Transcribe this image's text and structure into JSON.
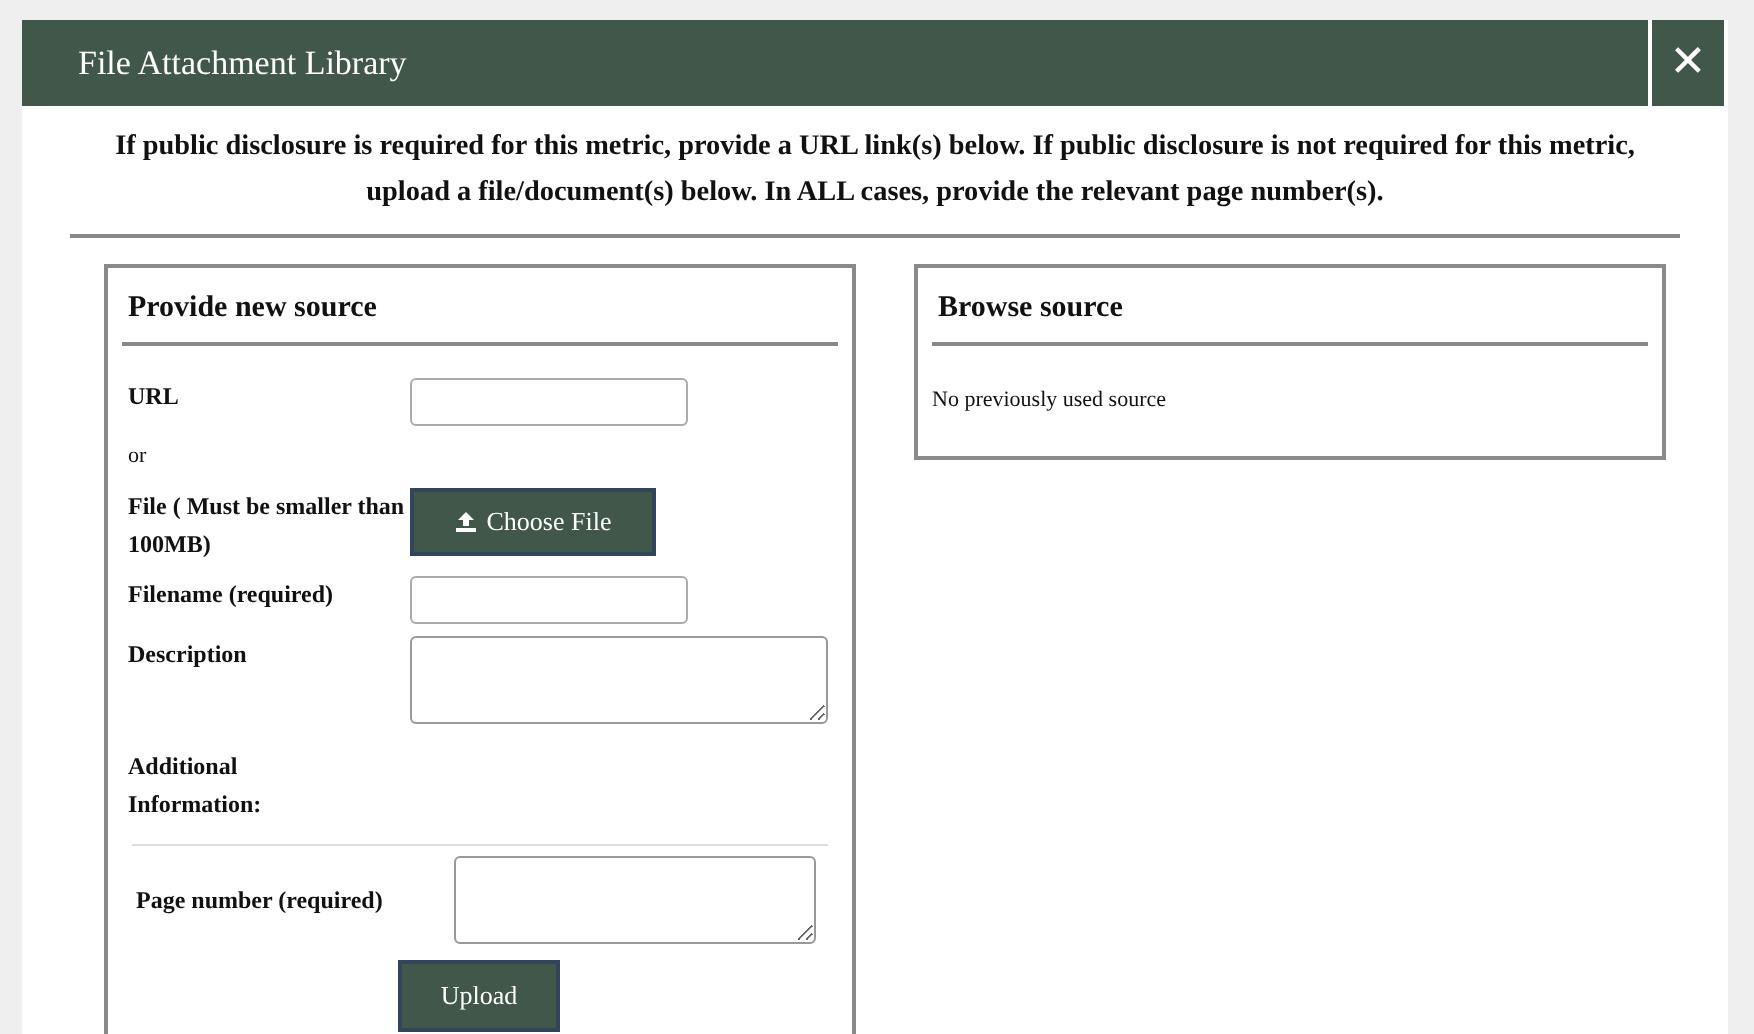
{
  "window": {
    "title": "File Attachment Library",
    "close": "✕"
  },
  "instructions": "If public disclosure is required for this metric, provide a URL link(s) below. If public disclosure is not required for this metric, upload a file/document(s) below. In ALL cases, provide the relevant page number(s).",
  "new_source": {
    "title": "Provide new source",
    "fields": [
      {
        "kind": "text",
        "label": "URL"
      },
      {
        "kind": "note",
        "label": "or"
      },
      {
        "kind": "file",
        "label": "File ( Must be smaller than 100MB)",
        "button": "Choose File"
      },
      {
        "kind": "text",
        "label": "Filename (required)"
      },
      {
        "kind": "textarea",
        "label": "Description"
      },
      {
        "kind": "heading",
        "label": "Additional Information:"
      }
    ],
    "page_number": {
      "label": "Page number (required)"
    },
    "submit": "Upload"
  },
  "browse_source": {
    "title": "Browse source",
    "message": "No previously used source"
  }
}
